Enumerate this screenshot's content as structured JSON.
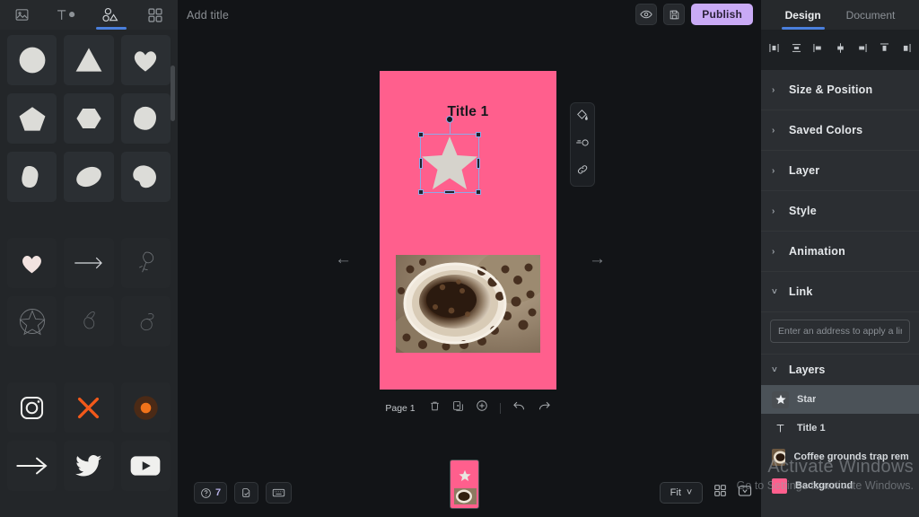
{
  "left_panel": {
    "tabs": [
      {
        "name": "image-tab",
        "icon": "image-icon",
        "active": false
      },
      {
        "name": "text-tab",
        "icon": "text-icon",
        "active": false
      },
      {
        "name": "shapes-tab",
        "icon": "shapes-icon",
        "active": true
      },
      {
        "name": "elements-tab",
        "icon": "grid-icon",
        "active": false
      }
    ],
    "shapes_group_1": [
      {
        "label": "circle-shape",
        "icon": "circle"
      },
      {
        "label": "triangle-shape",
        "icon": "triangle"
      },
      {
        "label": "heart-shape",
        "icon": "heart"
      },
      {
        "label": "pentagon-shape",
        "icon": "pentagon"
      },
      {
        "label": "hexagon-shape",
        "icon": "hexagon"
      },
      {
        "label": "blob-shape-1",
        "icon": "blob1"
      },
      {
        "label": "blob-shape-2",
        "icon": "blob2"
      },
      {
        "label": "blob-shape-3",
        "icon": "blob3"
      },
      {
        "label": "blob-shape-4",
        "icon": "blob4"
      }
    ],
    "shapes_group_2": [
      {
        "label": "heart-sticker",
        "icon": "heart-solid"
      },
      {
        "label": "arrow-sticker",
        "icon": "arrow-right"
      },
      {
        "label": "sketch-plant-1",
        "icon": "sketch1"
      },
      {
        "label": "sketch-starfish",
        "icon": "sketch2"
      },
      {
        "label": "sketch-plant-2",
        "icon": "sketch3"
      },
      {
        "label": "sketch-plant-3",
        "icon": "sketch4"
      }
    ],
    "shapes_group_3": [
      {
        "label": "instagram-icon",
        "icon": "instagram"
      },
      {
        "label": "x-cross-icon",
        "icon": "x-cross"
      },
      {
        "label": "circle-dot-icon",
        "icon": "circle-dot"
      },
      {
        "label": "arrow-right-icon",
        "icon": "arrow-long"
      },
      {
        "label": "twitter-icon",
        "icon": "twitter"
      },
      {
        "label": "youtube-icon",
        "icon": "youtube"
      }
    ]
  },
  "topbar": {
    "title_placeholder": "Add title",
    "preview_label": "preview",
    "save_label": "save",
    "publish_label": "Publish"
  },
  "canvas": {
    "artboard_title": "Title 1",
    "background_color": "#ff5f8d",
    "star_fill": "#d6d3cc",
    "page_label": "Page 1",
    "nav_prev": "←",
    "nav_next": "→",
    "float_tools": [
      "fill-color-icon",
      "opacity-icon",
      "link-icon"
    ],
    "page_tools": [
      "delete-icon",
      "duplicate-icon",
      "add-page-icon",
      "undo-icon",
      "redo-icon"
    ]
  },
  "bottom_left": {
    "help_badge": "7",
    "help_label": "help-icon",
    "check_label": "checkdoc-icon",
    "keyboard_label": "keyboard-icon"
  },
  "bottom_right": {
    "zoom_value": "Fit",
    "zoom_caret": "˅",
    "grid_label": "grid-view-icon",
    "fullscreen_label": "fit-screen-icon"
  },
  "right_panel": {
    "tabs": [
      {
        "label": "Design",
        "active": true
      },
      {
        "label": "Document",
        "active": false
      }
    ],
    "align_tools": [
      "align-vertical-center-icon",
      "distribute-horizontal-icon",
      "align-left-icon",
      "align-center-icon",
      "align-right-icon",
      "align-top-icon",
      "align-bottom-icon"
    ],
    "sections": [
      {
        "label": "Size & Position",
        "expanded": false
      },
      {
        "label": "Saved Colors",
        "expanded": false
      },
      {
        "label": "Layer",
        "expanded": false
      },
      {
        "label": "Style",
        "expanded": false
      },
      {
        "label": "Animation",
        "expanded": false
      },
      {
        "label": "Link",
        "expanded": true
      }
    ],
    "link_placeholder": "Enter an address to apply a link",
    "layers_title": "Layers",
    "layers": [
      {
        "name": "Star",
        "icon": "star-icon",
        "selected": true
      },
      {
        "name": "Title 1",
        "icon": "text-icon",
        "selected": false
      },
      {
        "name": "Coffee grounds trap remedies",
        "icon": "image-thumb",
        "selected": false
      },
      {
        "name": "Background",
        "icon": "color-swatch",
        "selected": false
      }
    ]
  },
  "watermark": {
    "line1": "Activate Windows",
    "line2": "Go to Settings to activate Windows."
  },
  "chevrons": {
    "collapsed": "›",
    "expanded": "˅"
  }
}
